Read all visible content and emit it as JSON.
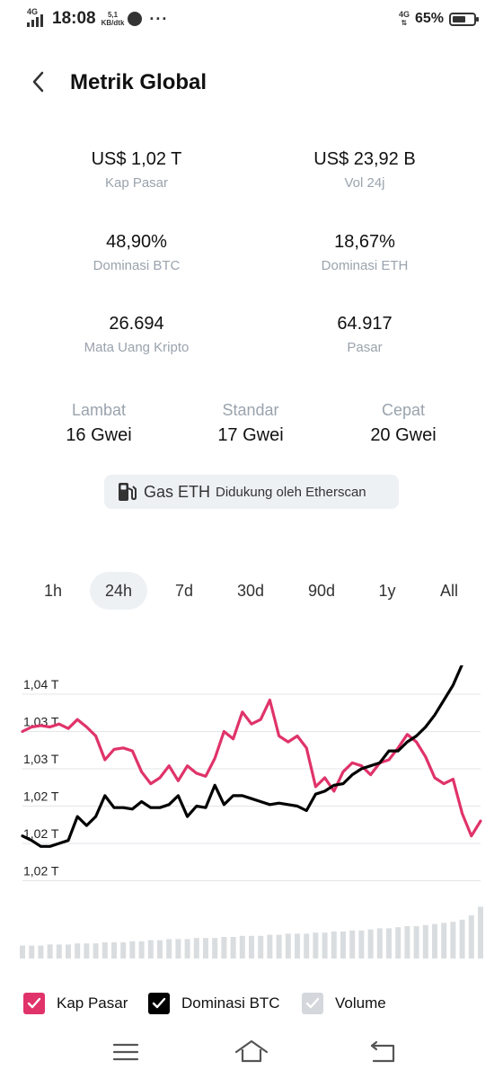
{
  "status_bar": {
    "time": "18:08",
    "network_left": "4G",
    "speed_value": "5,1",
    "speed_unit": "KB/dtk",
    "network_right": "4G",
    "battery_percent": "65%",
    "battery_level": 0.65
  },
  "header": {
    "title": "Metrik Global",
    "back_icon": "chevron-left-icon"
  },
  "metrics": [
    {
      "value": "US$ 1,02 T",
      "label": "Kap Pasar"
    },
    {
      "value": "US$ 23,92 B",
      "label": "Vol 24j"
    },
    {
      "value": "48,90%",
      "label": "Dominasi BTC"
    },
    {
      "value": "18,67%",
      "label": "Dominasi ETH"
    },
    {
      "value": "26.694",
      "label": "Mata Uang Kripto"
    },
    {
      "value": "64.917",
      "label": "Pasar"
    }
  ],
  "gas": {
    "tiers": [
      {
        "label": "Lambat",
        "value": "16 Gwei"
      },
      {
        "label": "Standar",
        "value": "17 Gwei"
      },
      {
        "label": "Cepat",
        "value": "20 Gwei"
      }
    ],
    "chip_title": "Gas ETH",
    "chip_subtitle": "Didukung oleh Etherscan",
    "chip_icon": "fuel-pump-icon"
  },
  "range_tabs": {
    "items": [
      "1h",
      "24h",
      "7d",
      "30d",
      "90d",
      "1y",
      "All"
    ],
    "selected": "24h"
  },
  "chart_data": {
    "type": "line",
    "y_tick_labels": [
      "1,04 T",
      "1,03 T",
      "1,03 T",
      "1,02 T",
      "1,02 T",
      "1,02 T"
    ],
    "grid": true,
    "series": [
      {
        "name": "Kap Pasar",
        "color": "#e0336a",
        "values": [
          0.75,
          0.78,
          0.79,
          0.78,
          0.8,
          0.77,
          0.83,
          0.78,
          0.72,
          0.56,
          0.63,
          0.64,
          0.62,
          0.48,
          0.4,
          0.44,
          0.52,
          0.42,
          0.52,
          0.47,
          0.45,
          0.57,
          0.75,
          0.7,
          0.88,
          0.8,
          0.83,
          0.96,
          0.72,
          0.68,
          0.72,
          0.64,
          0.38,
          0.44,
          0.35,
          0.48,
          0.54,
          0.52,
          0.46,
          0.54,
          0.56,
          0.64,
          0.73,
          0.68,
          0.58,
          0.44,
          0.4,
          0.43,
          0.2,
          0.05,
          0.15
        ]
      },
      {
        "name": "Dominasi BTC",
        "color": "#000000",
        "values": [
          0.05,
          0.02,
          -0.02,
          -0.02,
          0.0,
          0.02,
          0.18,
          0.12,
          0.18,
          0.32,
          0.24,
          0.24,
          0.23,
          0.28,
          0.24,
          0.24,
          0.26,
          0.32,
          0.18,
          0.25,
          0.24,
          0.39,
          0.26,
          0.32,
          0.32,
          0.3,
          0.28,
          0.26,
          0.27,
          0.26,
          0.25,
          0.22,
          0.33,
          0.35,
          0.39,
          0.4,
          0.46,
          0.5,
          0.52,
          0.54,
          0.62,
          0.62,
          0.68,
          0.72,
          0.78,
          0.86,
          0.96,
          1.06,
          1.2,
          1.34,
          1.4
        ]
      },
      {
        "name": "Volume",
        "color": "#d4d7db",
        "values": [
          0.12,
          0.12,
          0.12,
          0.13,
          0.13,
          0.13,
          0.14,
          0.14,
          0.14,
          0.15,
          0.15,
          0.15,
          0.16,
          0.16,
          0.17,
          0.17,
          0.18,
          0.18,
          0.18,
          0.19,
          0.19,
          0.19,
          0.2,
          0.2,
          0.21,
          0.21,
          0.21,
          0.22,
          0.22,
          0.23,
          0.23,
          0.23,
          0.24,
          0.24,
          0.25,
          0.25,
          0.26,
          0.26,
          0.27,
          0.28,
          0.28,
          0.29,
          0.3,
          0.3,
          0.31,
          0.32,
          0.33,
          0.34,
          0.36,
          0.4,
          0.48
        ]
      }
    ]
  },
  "legend": [
    {
      "label": "Kap Pasar",
      "color": "#e0336a",
      "checked": true
    },
    {
      "label": "Dominasi BTC",
      "color": "#000000",
      "checked": true
    },
    {
      "label": "Volume",
      "color": "#d4d7db",
      "checked": true
    }
  ],
  "nav_bar": {
    "icons": [
      "menu-icon",
      "home-icon",
      "back-icon"
    ]
  }
}
